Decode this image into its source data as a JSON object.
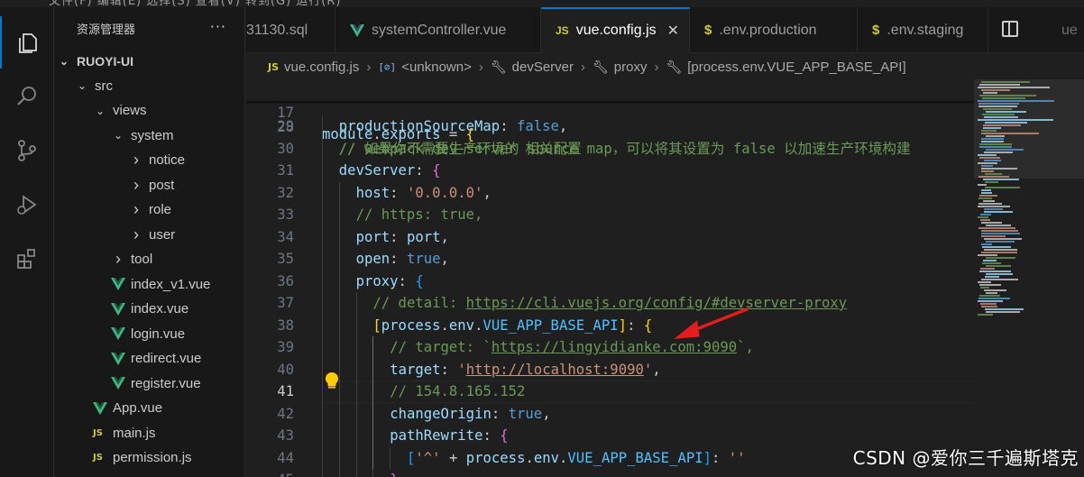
{
  "menubar": {
    "text": "文件(F)  编辑(E)  选择(S)  查看(V)  转到(G)  运行(R)"
  },
  "sidebar": {
    "title": "资源管理器",
    "more": "···",
    "project": "RUOYI-UI",
    "items": [
      {
        "label": "src",
        "kind": "folder-open",
        "depth": 1
      },
      {
        "label": "views",
        "kind": "folder-open",
        "depth": 2
      },
      {
        "label": "system",
        "kind": "folder-open",
        "depth": 3
      },
      {
        "label": "notice",
        "kind": "folder-closed",
        "depth": 4
      },
      {
        "label": "post",
        "kind": "folder-closed",
        "depth": 4
      },
      {
        "label": "role",
        "kind": "folder-closed",
        "depth": 4
      },
      {
        "label": "user",
        "kind": "folder-closed",
        "depth": 4
      },
      {
        "label": "tool",
        "kind": "folder-closed",
        "depth": 3
      },
      {
        "label": "index_v1.vue",
        "kind": "vue",
        "depth": 3
      },
      {
        "label": "index.vue",
        "kind": "vue",
        "depth": 3
      },
      {
        "label": "login.vue",
        "kind": "vue",
        "depth": 3
      },
      {
        "label": "redirect.vue",
        "kind": "vue",
        "depth": 3
      },
      {
        "label": "register.vue",
        "kind": "vue",
        "depth": 3
      },
      {
        "label": "App.vue",
        "kind": "vue",
        "depth": 2
      },
      {
        "label": "main.js",
        "kind": "js",
        "depth": 2
      },
      {
        "label": "permission.js",
        "kind": "js",
        "depth": 2
      }
    ]
  },
  "tabs": [
    {
      "label": "31130.sql",
      "icon": "",
      "active": false
    },
    {
      "label": "systemController.vue",
      "icon": "vue",
      "active": false
    },
    {
      "label": "vue.config.js",
      "icon": "JS",
      "active": true,
      "close": "✕"
    },
    {
      "label": ".env.production",
      "icon": "$",
      "active": false
    },
    {
      "label": ".env.staging",
      "icon": "$",
      "active": false
    },
    {
      "label": "ue",
      "icon": "",
      "active": false
    }
  ],
  "breadcrumb": {
    "file": "vue.config.js",
    "file_icon": "JS",
    "unknown_icon": "[⊘]",
    "unknown": "<unknown>",
    "devServer": "devServer",
    "proxy": "proxy",
    "key": "[process.env.VUE_APP_BASE_API]"
  },
  "editor": {
    "sticky": {
      "num": "17",
      "text": "module.exports = {"
    },
    "partial_line": {
      "num": "28",
      "text": "  // 如果你不需要生产环境的 source map，可以将其设置为 false 以加速生产环境构建"
    },
    "lines": [
      {
        "num": "29",
        "text": "productionSourceMap: false,"
      },
      {
        "num": "30",
        "text": "// webpack-dev-server 相关配置"
      },
      {
        "num": "31",
        "text": "devServer: {"
      },
      {
        "num": "32",
        "text": "host: '0.0.0.0',"
      },
      {
        "num": "33",
        "text": "// https: true,"
      },
      {
        "num": "34",
        "text": "port: port,"
      },
      {
        "num": "35",
        "text": "open: true,"
      },
      {
        "num": "36",
        "text": "proxy: {"
      },
      {
        "num": "37",
        "text": "// detail: https://cli.vuejs.org/config/#devserver-proxy"
      },
      {
        "num": "38",
        "text": "[process.env.VUE_APP_BASE_API]: {"
      },
      {
        "num": "39",
        "text": "// target: `https://lingyidianke.com:9090`,"
      },
      {
        "num": "40",
        "text": "target: 'http://localhost:9090',"
      },
      {
        "num": "41",
        "text": "// 154.8.165.152"
      },
      {
        "num": "42",
        "text": "changeOrigin: true,"
      },
      {
        "num": "43",
        "text": "pathRewrite: {"
      },
      {
        "num": "44",
        "text": "['^' + process.env.VUE_APP_BASE_API]: ''"
      },
      {
        "num": "45",
        "text": "}"
      }
    ],
    "current_line": "41"
  },
  "watermark": "CSDN @爱你三千遍斯塔克",
  "colors": {
    "accent": "#0078d4",
    "vue_green": "#41b883",
    "js_yellow": "#cbcb41",
    "arrow_red": "#e51c1c"
  }
}
